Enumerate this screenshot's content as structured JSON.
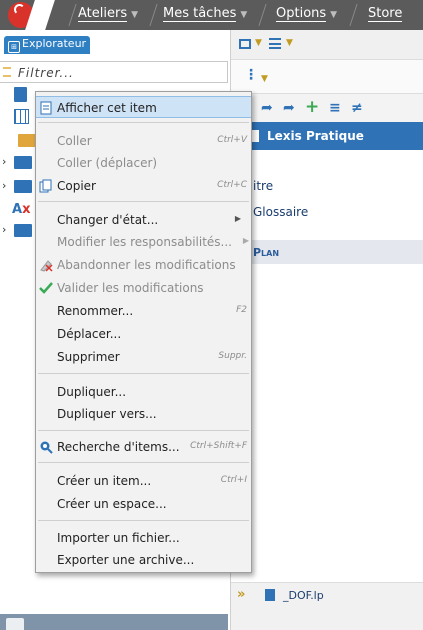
{
  "topbar": {
    "menus": [
      {
        "label": "Ateliers",
        "caret": "▼"
      },
      {
        "label": "Mes tâches",
        "caret": "▼"
      },
      {
        "label": "Options",
        "caret": "▼"
      },
      {
        "label": "Store",
        "caret": ""
      }
    ]
  },
  "left": {
    "tab_label": "Explorateur",
    "filter_placeholder": "Filtrer...",
    "tree_item_label": "DOF.lp",
    "tree_ax_label": "A"
  },
  "right": {
    "doc_title": "Lexis Pratique",
    "links": [
      "itre",
      "Glossaire"
    ],
    "plan_label": "Plan",
    "bottom_doc": "_DOF.lp"
  },
  "context_menu": {
    "items": [
      {
        "label": "Afficher cet item",
        "shortcut": "",
        "disabled": false,
        "highlighted": true
      },
      {
        "label": "Coller",
        "shortcut": "Ctrl+V",
        "disabled": true
      },
      {
        "label": "Coller (déplacer)",
        "shortcut": "",
        "disabled": true
      },
      {
        "label": "Copier",
        "shortcut": "Ctrl+C",
        "disabled": false
      },
      {
        "label": "Changer d'état...",
        "shortcut": "",
        "disabled": false,
        "submenu": true
      },
      {
        "label": "Modifier les responsabilités...",
        "shortcut": "",
        "disabled": true,
        "submenu": true
      },
      {
        "label": "Abandonner les modifications",
        "shortcut": "",
        "disabled": true
      },
      {
        "label": "Valider les modifications",
        "shortcut": "",
        "disabled": true
      },
      {
        "label": "Renommer...",
        "shortcut": "F2",
        "disabled": false
      },
      {
        "label": "Déplacer...",
        "shortcut": "",
        "disabled": false
      },
      {
        "label": "Supprimer",
        "shortcut": "Suppr.",
        "disabled": false
      },
      {
        "label": "Dupliquer...",
        "shortcut": "",
        "disabled": false
      },
      {
        "label": "Dupliquer vers...",
        "shortcut": "",
        "disabled": false
      },
      {
        "label": "Recherche d'items...",
        "shortcut": "Ctrl+Shift+F",
        "disabled": false
      },
      {
        "label": "Créer un item...",
        "shortcut": "Ctrl+I",
        "disabled": false
      },
      {
        "label": "Créer un espace...",
        "shortcut": "",
        "disabled": false
      },
      {
        "label": "Importer un fichier...",
        "shortcut": "",
        "disabled": false
      },
      {
        "label": "Exporter une archive...",
        "shortcut": "",
        "disabled": false
      }
    ]
  },
  "colors": {
    "brand_red": "#d8322b",
    "accent_blue": "#2f72b6",
    "highlight": "#cfe3f7",
    "success_green": "#3aaa55",
    "caret_gold": "#c29b22"
  },
  "icons": [
    "lexis-logo-icon",
    "explorer-icon",
    "filter-icon",
    "document-icon",
    "table-icon",
    "folder-icon",
    "paste-icon",
    "copy-icon",
    "discard-icon",
    "validate-check-icon",
    "search-icon"
  ]
}
